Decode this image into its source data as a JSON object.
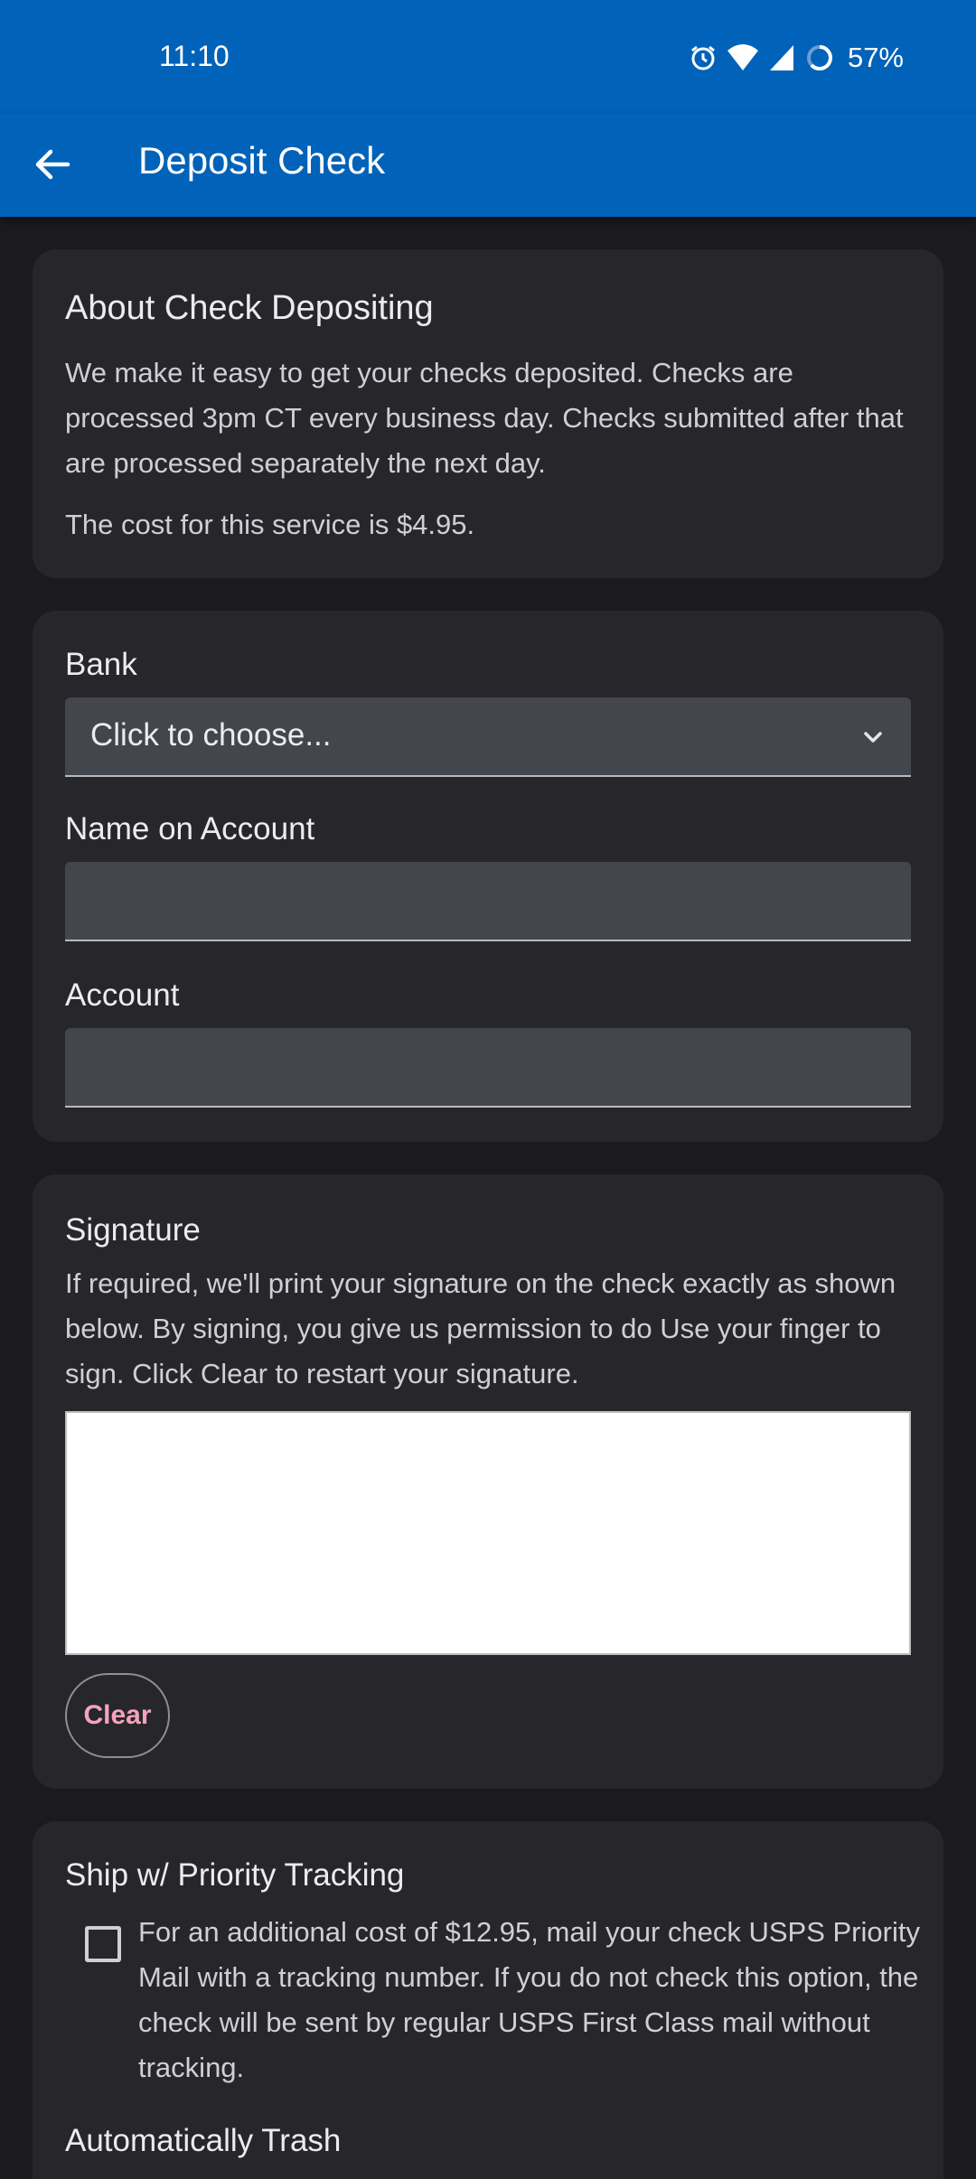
{
  "status_bar": {
    "time": "11:10",
    "battery": "57%",
    "icons": [
      "alarm-icon",
      "wifi-icon",
      "signal-icon",
      "battery-icon"
    ]
  },
  "app_bar": {
    "back_icon": "arrow-left-icon",
    "title": "Deposit Check"
  },
  "about": {
    "title": "About Check Depositing",
    "paragraph": "We make it easy to get your checks deposited. Checks are processed 3pm CT every business day. Checks submitted after that are processed separately the next day.",
    "cost": "The cost for this service is $4.95."
  },
  "form": {
    "bank_label": "Bank",
    "bank_value": "Click to choose...",
    "name_label": "Name on Account",
    "name_value": "",
    "account_label": "Account",
    "account_value": ""
  },
  "signature": {
    "title": "Signature",
    "description": "If required, we'll print your signature on the check exactly as shown below. By signing, you give us permission to do  Use your finger to sign. Click Clear to restart your signature.",
    "clear_label": "Clear"
  },
  "shipping": {
    "title": "Ship w/ Priority Tracking",
    "description": "For an additional cost of $12.95, mail your check USPS Priority Mail with a tracking number. If you do not check this option, the check will be sent by regular USPS First Class mail without tracking.",
    "checked": false,
    "next_section_title": "Automatically Trash"
  },
  "colors": {
    "primary": "#0062b8",
    "background": "#1b1b1f",
    "card": "#26262b",
    "field": "#44464d",
    "clear_text": "#f5a3ba"
  }
}
